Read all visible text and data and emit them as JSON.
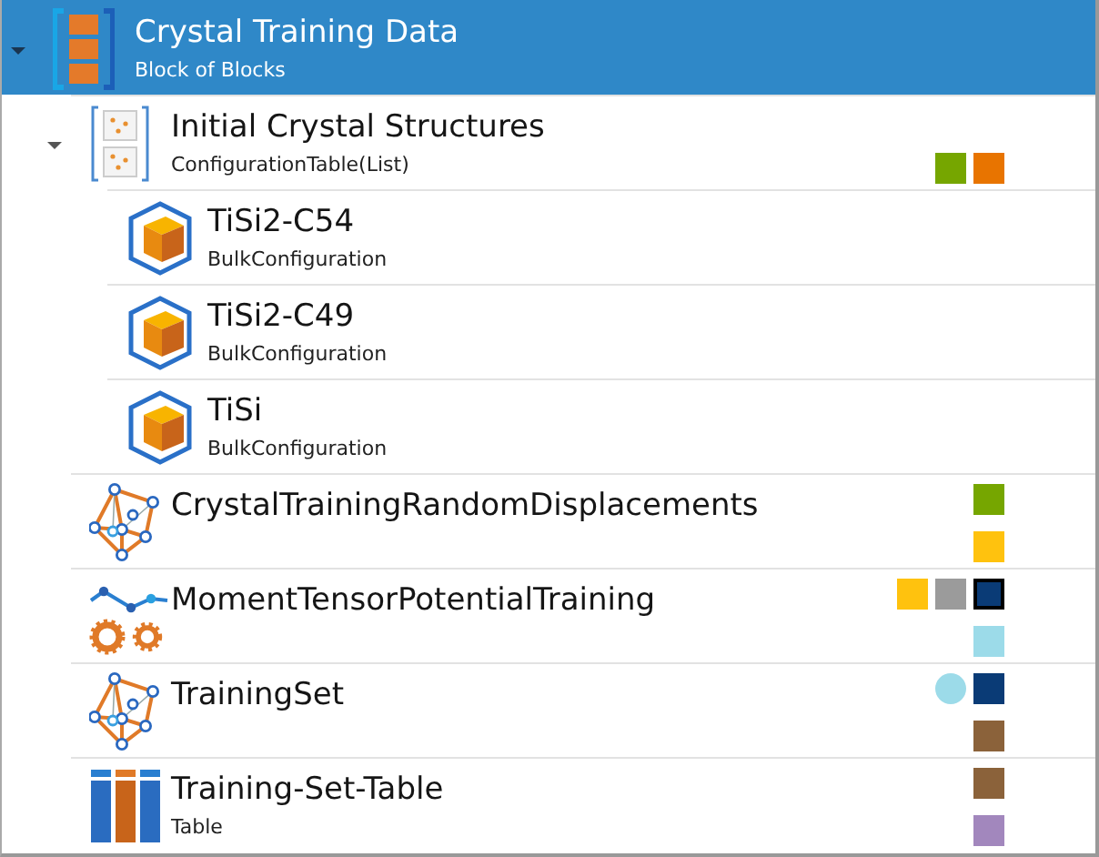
{
  "tree": {
    "title": "Crystal Training Data",
    "subtitle": "Block of Blocks",
    "kind": "block",
    "selected": true,
    "expanded": true,
    "children": [
      {
        "title": "Initial Crystal Structures",
        "subtitle": "ConfigurationTable(List)",
        "kind": "table-list",
        "selected": false,
        "expanded": true,
        "markers_bottom": [
          {
            "kind": "square",
            "color": "#76a600",
            "outlined": false
          },
          {
            "kind": "square",
            "color": "#e87400",
            "outlined": false
          }
        ],
        "children": [
          {
            "title": "TiSi2-C54",
            "subtitle": "BulkConfiguration",
            "kind": "bulk",
            "selected": false
          },
          {
            "title": "TiSi2-C49",
            "subtitle": "BulkConfiguration",
            "kind": "bulk",
            "selected": false
          },
          {
            "title": "TiSi",
            "subtitle": "BulkConfiguration",
            "kind": "bulk",
            "selected": false
          }
        ]
      },
      {
        "title": "CrystalTrainingRandomDisplacements",
        "kind": "network",
        "selected": false,
        "markers_top": [
          {
            "kind": "square",
            "color": "#76a600",
            "outlined": false
          }
        ],
        "markers_bottom": [
          {
            "kind": "square",
            "color": "#ffc20e",
            "outlined": false
          }
        ]
      },
      {
        "title": "MomentTensorPotentialTraining",
        "kind": "training",
        "selected": false,
        "markers_top": [
          {
            "kind": "square",
            "color": "#ffc20e",
            "outlined": false
          },
          {
            "kind": "square",
            "color": "#9b9b9b",
            "outlined": false
          },
          {
            "kind": "square",
            "color": "#0a3b76",
            "outlined": true
          }
        ],
        "markers_bottom": [
          {
            "kind": "square",
            "color": "#9cdbe9",
            "outlined": false
          }
        ]
      },
      {
        "title": "TrainingSet",
        "kind": "network",
        "selected": false,
        "markers_top": [
          {
            "kind": "circle",
            "color": "#9cdbe9",
            "outlined": false
          },
          {
            "kind": "square",
            "color": "#0a3b76",
            "outlined": false
          }
        ],
        "markers_bottom": [
          {
            "kind": "square",
            "color": "#8b623a",
            "outlined": false
          }
        ]
      },
      {
        "title": "Training-Set-Table",
        "subtitle": "Table",
        "kind": "table",
        "selected": false,
        "markers_top": [
          {
            "kind": "square",
            "color": "#8b623a",
            "outlined": false
          }
        ],
        "markers_bottom": [
          {
            "kind": "square",
            "color": "#a287bd",
            "outlined": false
          }
        ]
      }
    ]
  }
}
